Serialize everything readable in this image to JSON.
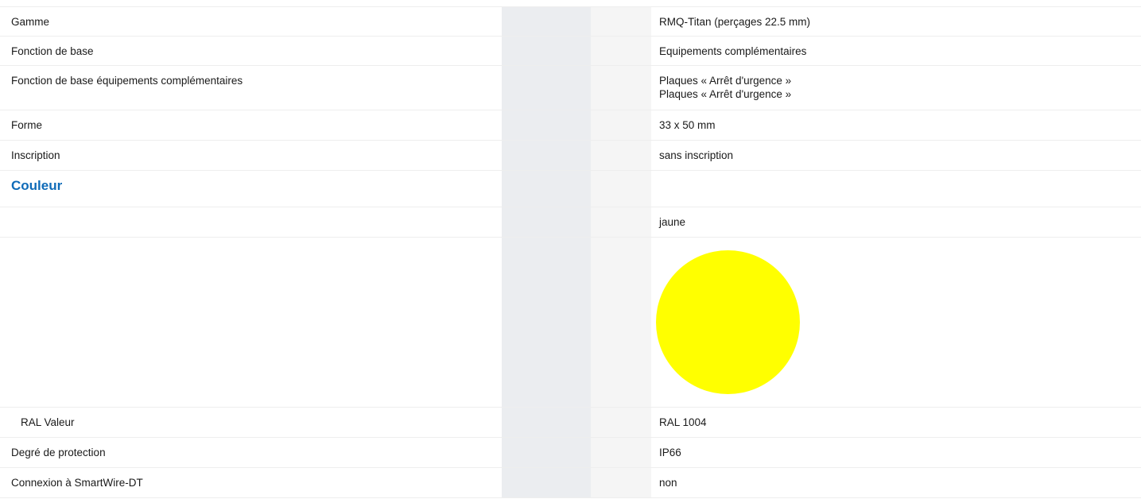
{
  "rows": [
    {
      "label": "Gamme",
      "value": "RMQ-Titan (perçages 22.5 mm)"
    },
    {
      "label": "Fonction de base",
      "value": "Equipements complémentaires"
    },
    {
      "label": "Fonction de base équipements complémentaires",
      "value_lines": [
        "Plaques « Arrêt d'urgence »",
        "Plaques « Arrêt d'urgence »"
      ]
    },
    {
      "label": "Forme",
      "value": "33 x 50 mm"
    },
    {
      "label": "Inscription",
      "value": "sans inscription"
    }
  ],
  "section": {
    "title": "Couleur"
  },
  "color": {
    "name": "jaune",
    "swatch_color": "#ffff00",
    "ral_label": "RAL Valeur",
    "ral_value": "RAL 1004"
  },
  "rows_after": [
    {
      "label": "Degré de protection",
      "value": "IP66"
    },
    {
      "label": "Connexion à SmartWire-DT",
      "value": "non"
    }
  ],
  "colors": {
    "section_title": "#0f6bb8",
    "gap_column": "#ebedf0",
    "divider": "#eeeeee"
  }
}
